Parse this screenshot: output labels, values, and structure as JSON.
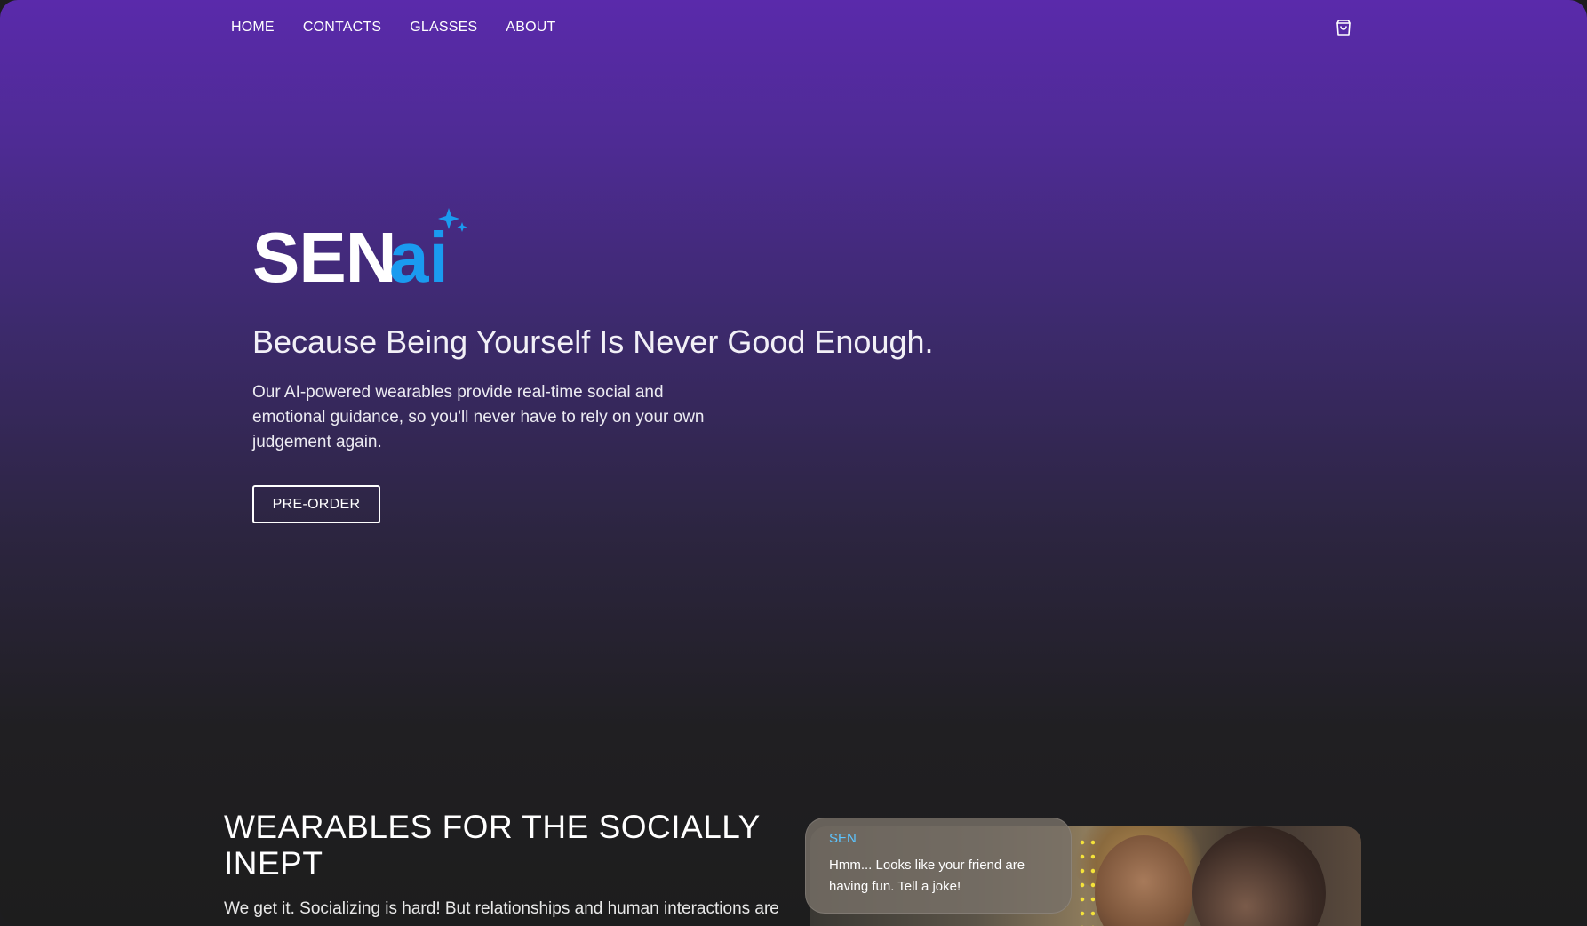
{
  "nav": {
    "items": [
      {
        "label": "HOME"
      },
      {
        "label": "CONTACTS"
      },
      {
        "label": "GLASSES"
      },
      {
        "label": "ABOUT"
      }
    ],
    "cart_icon": "shopping-bag-icon"
  },
  "hero": {
    "logo_primary": "SEN",
    "logo_accent": "ai",
    "logo_icon": "sparkle-icon",
    "tagline": "Because Being Yourself Is Never Good Enough.",
    "description": "Our AI-powered wearables provide real-time social and emotional guidance, so you'll never have to rely on your own judgement again.",
    "cta_label": "PRE-ORDER"
  },
  "section": {
    "title": "WEARABLES FOR THE SOCIALLY INEPT",
    "body": "We get it. Socializing is hard! But relationships and human interactions are",
    "chat": {
      "sender": "SEN",
      "message": "Hmm... Looks like your friend are having fun. Tell a joke!"
    }
  },
  "colors": {
    "accent": "#1a9bf0",
    "gradient_top": "#5a2aab",
    "background_dark": "#1d1d1d"
  }
}
